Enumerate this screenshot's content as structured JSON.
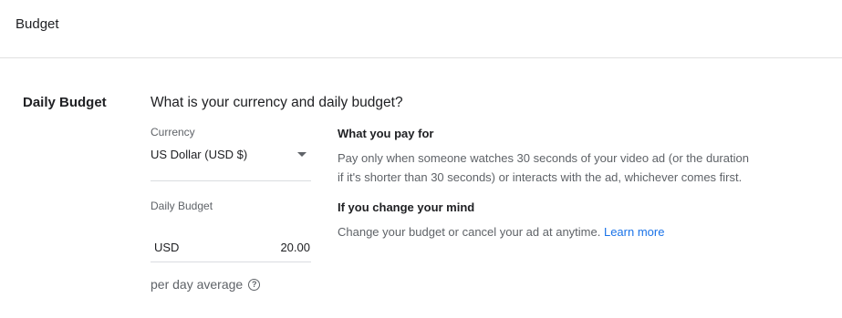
{
  "header": {
    "title": "Budget"
  },
  "section": {
    "label": "Daily Budget",
    "question": "What is your currency and daily budget?"
  },
  "currency": {
    "label": "Currency",
    "value": "US Dollar (USD $)"
  },
  "daily_budget": {
    "label": "Daily Budget",
    "currency_code": "USD",
    "amount": "20.00"
  },
  "per_day": {
    "label": "per day average",
    "help_icon": "help-circle-icon"
  },
  "info": {
    "pay_title": "What you pay for",
    "pay_text_line1": "Pay only when someone watches 30 seconds of your video ad (or the duration",
    "pay_text_line2": "if it's shorter than 30 seconds) or interacts with the ad, whichever comes first.",
    "change_title": "If you change your mind",
    "change_text": "Change your budget or cancel your ad at anytime.",
    "learn_more": "Learn more"
  },
  "colors": {
    "link": "#1a73e8",
    "secondary_text": "#5f6368",
    "divider": "#e0e0e0"
  }
}
